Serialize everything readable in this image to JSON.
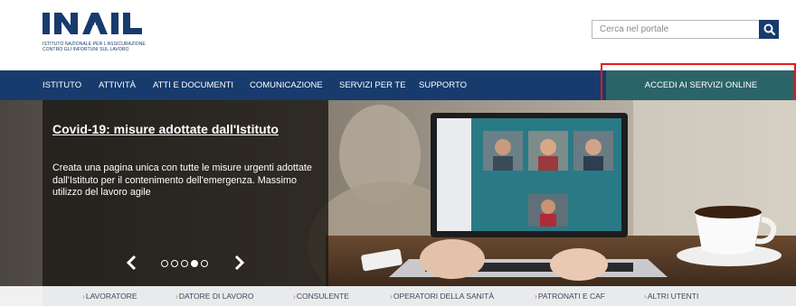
{
  "header": {
    "logo_text": "INAIL",
    "logo_subtitle_line1": "ISTITUTO NAZIONALE PER L'ASSICURAZIONE",
    "logo_subtitle_line2": "CONTRO GLI INFORTUNI SUL LAVORO",
    "search": {
      "placeholder": "Cerca nel portale",
      "value": "",
      "button_icon": "search-icon"
    }
  },
  "nav": {
    "items": [
      {
        "label": "ISTITUTO"
      },
      {
        "label": "ATTIVITÀ"
      },
      {
        "label": "ATTI E DOCUMENTI"
      },
      {
        "label": "COMUNICAZIONE"
      },
      {
        "label": "SERVIZI PER TE"
      },
      {
        "label": "SUPPORTO"
      }
    ],
    "cta_label": "ACCEDI AI SERVIZI ONLINE"
  },
  "hero": {
    "title": "Covid-19: misure adottate dall'Istituto",
    "text": "Creata una pagina unica con tutte le misure urgenti adottate dall'Istituto per il contenimento dell'emergenza. Massimo utilizzo del lavoro agile",
    "prev_icon": "chevron-left-icon",
    "next_icon": "chevron-right-icon",
    "slide_count": 5,
    "active_slide": 4
  },
  "bottom_links": [
    {
      "label": "LAVORATORE"
    },
    {
      "label": "DATORE DI LAVORO"
    },
    {
      "label": "CONSULENTE"
    },
    {
      "label": "OPERATORI DELLA SANITÀ"
    },
    {
      "label": "PATRONATI E CAF"
    },
    {
      "label": "ALTRI UTENTI"
    }
  ],
  "colors": {
    "brand_blue": "#173b6d",
    "cta_teal": "#2b6468",
    "highlight_red": "#e01a1a",
    "link_chevron": "#e07a2a"
  }
}
